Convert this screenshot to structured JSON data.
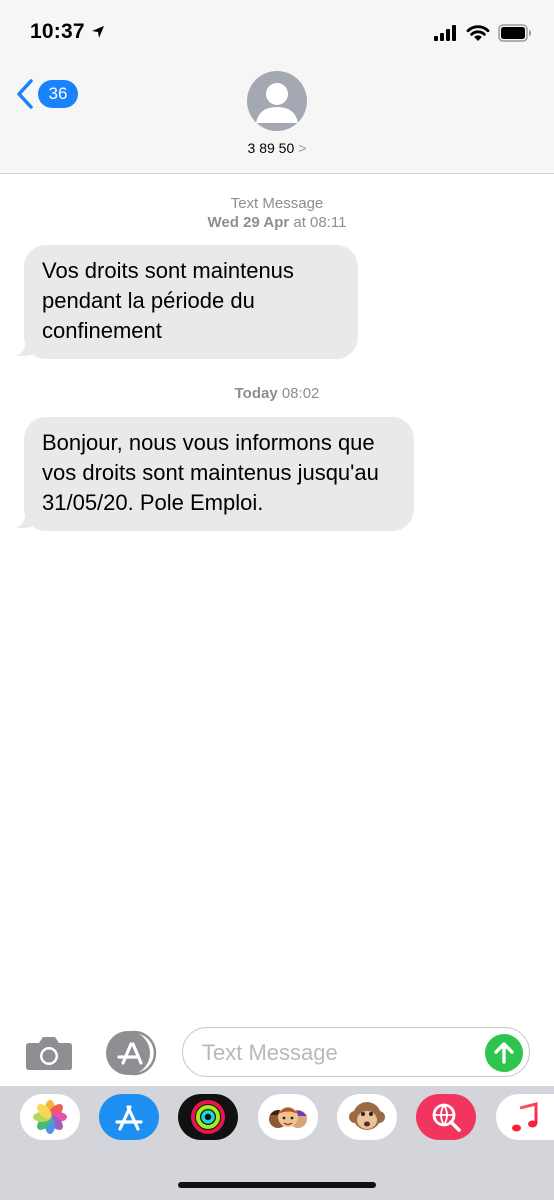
{
  "status_bar": {
    "time": "10:37"
  },
  "header": {
    "back_count": "36",
    "contact": "3 89 50",
    "contact_chevron": ">"
  },
  "conversation": {
    "group1": {
      "label": "Text Message",
      "date_bold": "Wed 29 Apr",
      "date_rest": " at 08:11",
      "message": "Vos droits sont maintenus pendant la période du confinement"
    },
    "group2": {
      "date_bold": "Today",
      "date_rest": " 08:02",
      "message": "Bonjour, nous vous informons que vos droits sont maintenus jusqu'au 31/05/20. Pole Emploi."
    }
  },
  "input_bar": {
    "placeholder": "Text Message"
  },
  "app_drawer": {
    "apps": [
      "photos-icon",
      "app-store-icon",
      "activity-icon",
      "memoji-icon",
      "animoji-monkey-icon",
      "web-images-icon",
      "music-icon"
    ]
  },
  "colors": {
    "accent_blue": "#1a82fb",
    "send_green": "#2ec44f",
    "bubble_gray": "#e9e9eb",
    "header_bg": "#f6f6f6",
    "drawer_bg": "#d3d5db"
  }
}
